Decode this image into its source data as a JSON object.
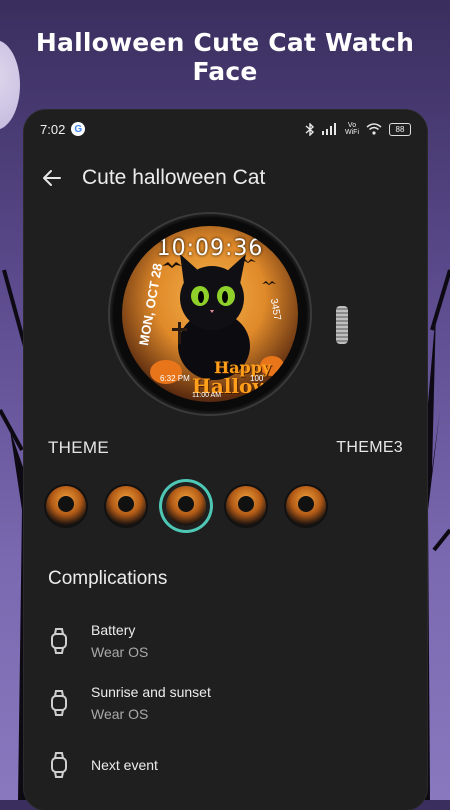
{
  "promo": {
    "title": "Halloween Cute Cat Watch Face"
  },
  "status_bar": {
    "time": "7:02",
    "g_badge": "G",
    "vowifi_top": "Vo",
    "vowifi_bottom": "WiFi",
    "battery": "88"
  },
  "app_bar": {
    "title": "Cute halloween Cat",
    "back_icon": "arrow-left-icon"
  },
  "watch_face": {
    "time": "10:09:36",
    "date": "MON, OCT 28",
    "steps": "3457",
    "sunrise": "6:32 PM",
    "battery": "100",
    "bottom": "11:00 AM",
    "greeting_1": "Happy",
    "greeting_2": "Halloween"
  },
  "theme": {
    "label": "THEME",
    "selected_value": "THEME3",
    "options_count_note": "5 theme thumbnails, third selected"
  },
  "complications": {
    "title": "Complications",
    "items": [
      {
        "name": "Battery",
        "provider": "Wear OS",
        "icon": "watch-icon"
      },
      {
        "name": "Sunrise and sunset",
        "provider": "Wear OS",
        "icon": "watch-icon"
      },
      {
        "name": "Next event",
        "provider": "",
        "icon": "watch-icon"
      }
    ]
  },
  "colors": {
    "accent_selected_ring": "#4ec7b5",
    "panel_bg": "#1f1f1f",
    "promo_bg": "#5b4a8c"
  }
}
